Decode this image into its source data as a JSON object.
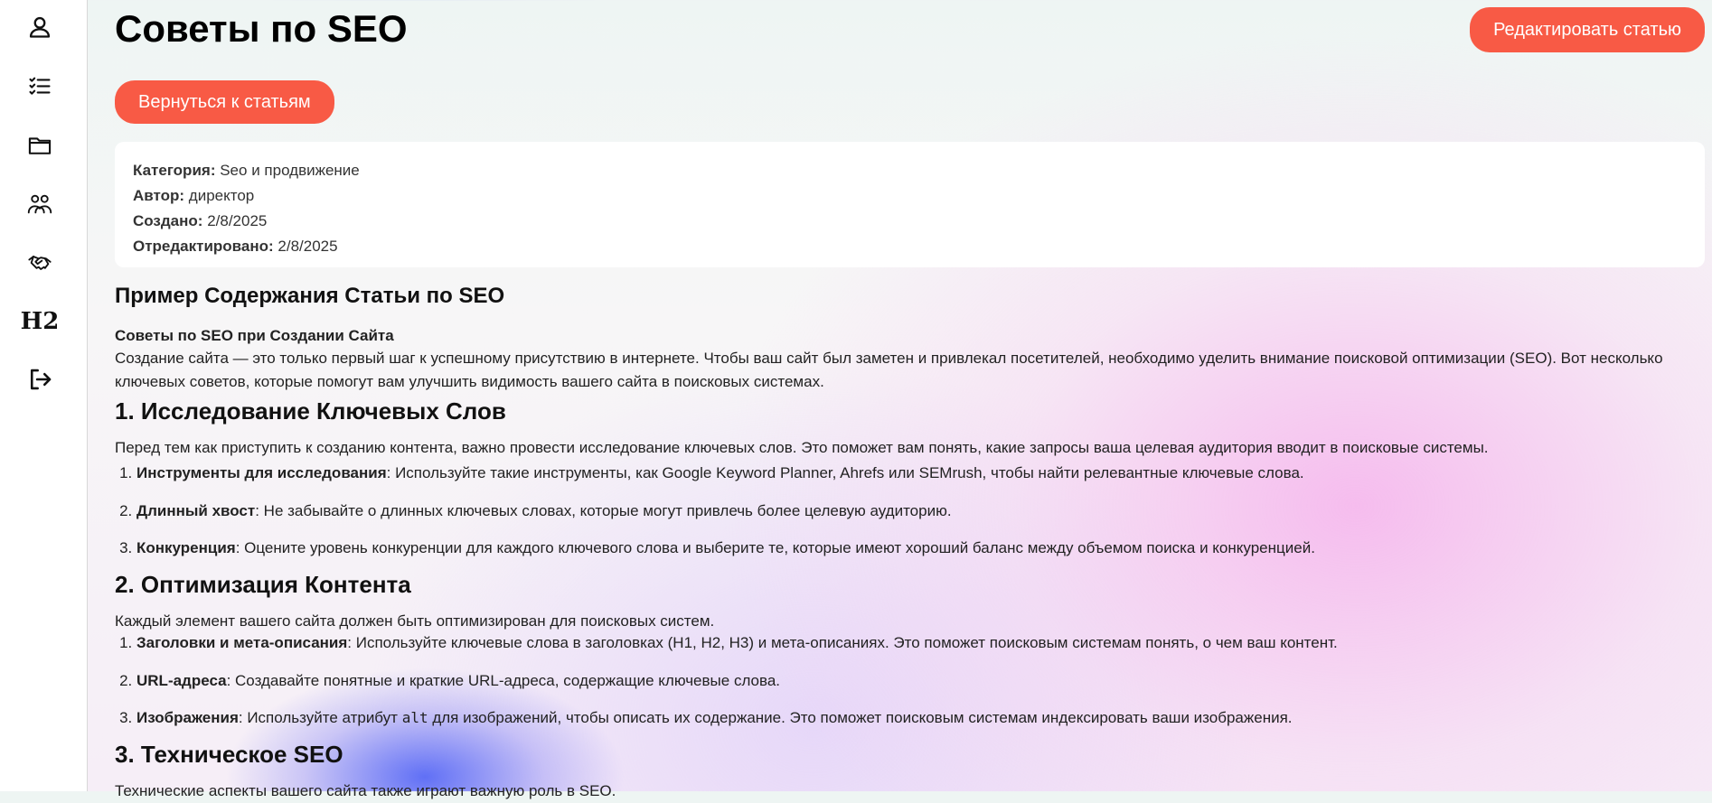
{
  "sidebar": {
    "items": [
      {
        "icon": "user-icon"
      },
      {
        "icon": "checklist-icon"
      },
      {
        "icon": "folder-icon"
      },
      {
        "icon": "users-icon"
      },
      {
        "icon": "handshake-icon"
      },
      {
        "icon": "heading-icon",
        "glyph": "H2"
      },
      {
        "icon": "logout-icon"
      }
    ]
  },
  "header": {
    "title": "Советы по SEO",
    "edit_button": "Редактировать статью",
    "back_button": "Вернуться к статьям"
  },
  "meta": {
    "category_label": "Категория:",
    "category_value": "Seo и продвижение",
    "author_label": "Автор:",
    "author_value": "директор",
    "created_label": "Создано:",
    "created_value": "2/8/2025",
    "edited_label": "Отредактировано:",
    "edited_value": "2/8/2025"
  },
  "article": {
    "heading": "Пример Содержания Статьи по SEO",
    "subheading": "Советы по SEO при Создании Сайта",
    "intro": "Создание сайта — это только первый шаг к успешному присутствию в интернете. Чтобы ваш сайт был заметен и привлекал посетителей, необходимо уделить внимание поисковой оптимизации (SEO). Вот несколько ключевых советов, которые помогут вам улучшить видимость вашего сайта в поисковых системах.",
    "sections": [
      {
        "title": "1. Исследование Ключевых Слов",
        "text": "Перед тем как приступить к созданию контента, важно провести исследование ключевых слов. Это поможет вам понять, какие запросы ваша целевая аудитория вводит в поисковые системы.",
        "items": [
          {
            "bold": "Инструменты для исследования",
            "text": ": Используйте такие инструменты, как Google Keyword Planner, Ahrefs или SEMrush, чтобы найти релевантные ключевые слова."
          },
          {
            "bold": "Длинный хвост",
            "text": ": Не забывайте о длинных ключевых словах, которые могут привлечь более целевую аудиторию."
          },
          {
            "bold": "Конкуренция",
            "text": ": Оцените уровень конкуренции для каждого ключевого слова и выберите те, которые имеют хороший баланс между объемом поиска и конкуренцией."
          }
        ]
      },
      {
        "title": "2. Оптимизация Контента",
        "text": "Каждый элемент вашего сайта должен быть оптимизирован для поисковых систем.",
        "items": [
          {
            "bold": "Заголовки и мета-описания",
            "text": ": Используйте ключевые слова в заголовках (H1, H2, H3) и мета-описаниях. Это поможет поисковым системам понять, о чем ваш контент."
          },
          {
            "bold": "URL-адреса",
            "text": ": Создавайте понятные и краткие URL-адреса, содержащие ключевые слова."
          },
          {
            "bold": "Изображения",
            "text_before": ": Используйте атрибут ",
            "code": "alt",
            "text_after": " для изображений, чтобы описать их содержание. Это поможет поисковым системам индексировать ваши изображения."
          }
        ]
      },
      {
        "title": "3. Техническое SEO",
        "text": "Технические аспекты вашего сайта также играют важную роль в SEO."
      }
    ]
  }
}
